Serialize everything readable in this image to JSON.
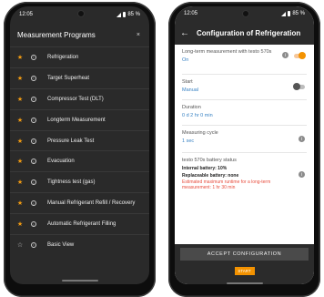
{
  "left": {
    "status": {
      "time": "12:05",
      "battery": "85 %"
    },
    "dialog_title": "Measurement Programs",
    "close_label": "×",
    "programs": [
      {
        "label": "Refrigeration",
        "favorite": true
      },
      {
        "label": "Target Superheat",
        "favorite": true
      },
      {
        "label": "Compressor Test (DLT)",
        "favorite": true
      },
      {
        "label": "Longterm Measurement",
        "favorite": true
      },
      {
        "label": "Pressure Leak Test",
        "favorite": true
      },
      {
        "label": "Evacuation",
        "favorite": true
      },
      {
        "label": "Tightness test (gas)",
        "favorite": true
      },
      {
        "label": "Manual Refrigerant Refill / Recovery",
        "favorite": true
      },
      {
        "label": "Automatic Refrigerant Filling",
        "favorite": true
      },
      {
        "label": "Basic View",
        "favorite": false
      }
    ]
  },
  "right": {
    "status": {
      "time": "12:05",
      "battery": "85 %"
    },
    "title": "Configuration of Refrigeration",
    "longterm": {
      "label": "Long-term measurement with testo 570s",
      "value": "On",
      "toggle": "on"
    },
    "start": {
      "label": "Start",
      "value": "Manual",
      "toggle": "off"
    },
    "duration": {
      "label": "Duration",
      "value": "0 d 2 hr 0 min"
    },
    "cycle": {
      "label": "Measuring cycle",
      "value": "1 sec"
    },
    "battery_status": {
      "label": "testo 570s battery status",
      "internal": "Internal battery: 10%",
      "replaceable": "Replaceable battery: none",
      "warning": "Estimated maximum runtime for a long-term measurement: 1 hr 30 min"
    },
    "accept_label": "ACCEPT CONFIGURATION",
    "start_label": "START"
  },
  "colors": {
    "accent": "#f39200",
    "link": "#3a83c4",
    "warning": "#e74c3c",
    "dark": "#2b2b2b"
  }
}
